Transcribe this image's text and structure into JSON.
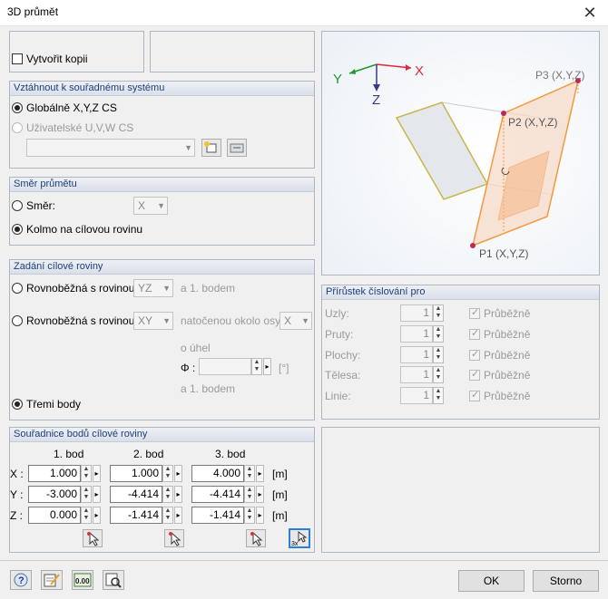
{
  "window": {
    "title": "3D průmět",
    "close_glyph": "✕"
  },
  "copy": {
    "label": "Vytvořit kopii",
    "checked": false
  },
  "coord_system": {
    "header": "Vztáhnout k souřadnému systému",
    "global_label": "Globálně X,Y,Z CS",
    "user_label": "Uživatelské U,V,W CS",
    "user_select_value": ""
  },
  "direction": {
    "header": "Směr průmětu",
    "dir_label": "Směr:",
    "dir_value": "X",
    "perp_label": "Kolmo na cílovou rovinu"
  },
  "target_plane": {
    "header": "Zadání cílové roviny",
    "parallel1_label": "Rovnoběžná s rovinou:",
    "parallel1_value": "YZ",
    "parallel1_suffix": "a 1. bodem",
    "parallel2_label": "Rovnoběžná s rovinou:",
    "parallel2_value": "XY",
    "rotated_label": "natočenou okolo osy:",
    "axis_value": "X",
    "angle_label": "o úhel",
    "angle_symbol": "Φ :",
    "angle_value": "",
    "angle_unit": "[°]",
    "point_suffix": "a 1. bodem",
    "three_points_label": "Třemi body"
  },
  "points": {
    "header": "Souřadnice bodů cílové roviny",
    "col_headers": [
      "1. bod",
      "2. bod",
      "3. bod"
    ],
    "rows": [
      {
        "label": "X :",
        "values": [
          "1.000",
          "1.000",
          "4.000"
        ],
        "unit": "[m]"
      },
      {
        "label": "Y :",
        "values": [
          "-3.000",
          "-4.414",
          "-4.414"
        ],
        "unit": "[m]"
      },
      {
        "label": "Z :",
        "values": [
          "0.000",
          "-1.414",
          "-1.414"
        ],
        "unit": "[m]"
      }
    ]
  },
  "preview": {
    "axis_x": "X",
    "axis_y": "Y",
    "axis_z": "Z",
    "p1_label": "P1 (X,Y,Z)",
    "p2_label": "P2 (X,Y,Z)",
    "p3_label": "P3 (X,Y,Z)",
    "colors": {
      "x_axis": "#e0283a",
      "y_axis": "#1c9a2e",
      "z_axis": "#3a3a8c",
      "plane": "#f29a3c",
      "point": "#c0285a"
    }
  },
  "numbering": {
    "header": "Přírůstek číslování pro",
    "rows": [
      {
        "label": "Uzly:",
        "value": "1",
        "check_label": "Průběžně"
      },
      {
        "label": "Pruty:",
        "value": "1",
        "check_label": "Průběžně"
      },
      {
        "label": "Plochy:",
        "value": "1",
        "check_label": "Průběžně"
      },
      {
        "label": "Tělesa:",
        "value": "1",
        "check_label": "Průběžně"
      },
      {
        "label": "Linie:",
        "value": "1",
        "check_label": "Průběžně"
      }
    ]
  },
  "footer": {
    "ok_label": "OK",
    "cancel_label": "Storno",
    "units_icon_text": "0.00"
  }
}
